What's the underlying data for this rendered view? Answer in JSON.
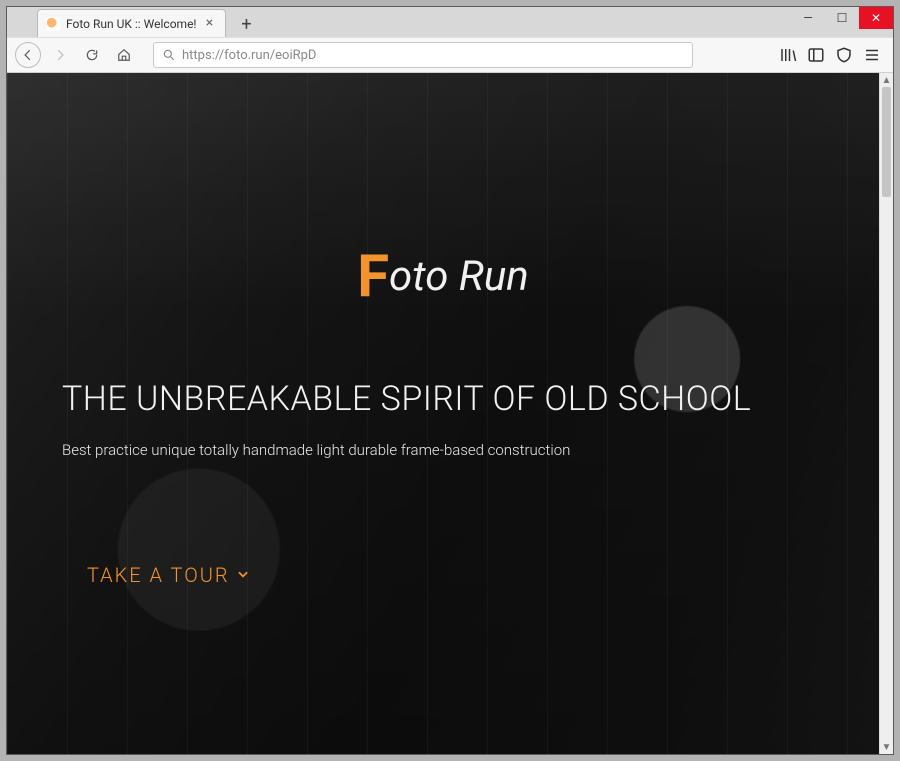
{
  "browser": {
    "tab_title": "Foto Run UK :: Welcome!",
    "url": "https://foto.run/eoiRpD",
    "new_tab_symbol": "+",
    "tab_close_symbol": "×",
    "win_min": "—",
    "win_max": "☐",
    "win_close": "✕"
  },
  "hero": {
    "logo_first_letter": "F",
    "logo_rest": "oto Run",
    "headline": "THE UNBREAKABLE SPIRIT OF OLD SCHOOL",
    "subhead": "Best practice unique totally handmade light durable frame-based construction",
    "cta_label": "TAKE A TOUR"
  },
  "colors": {
    "accent": "#f2932e"
  }
}
